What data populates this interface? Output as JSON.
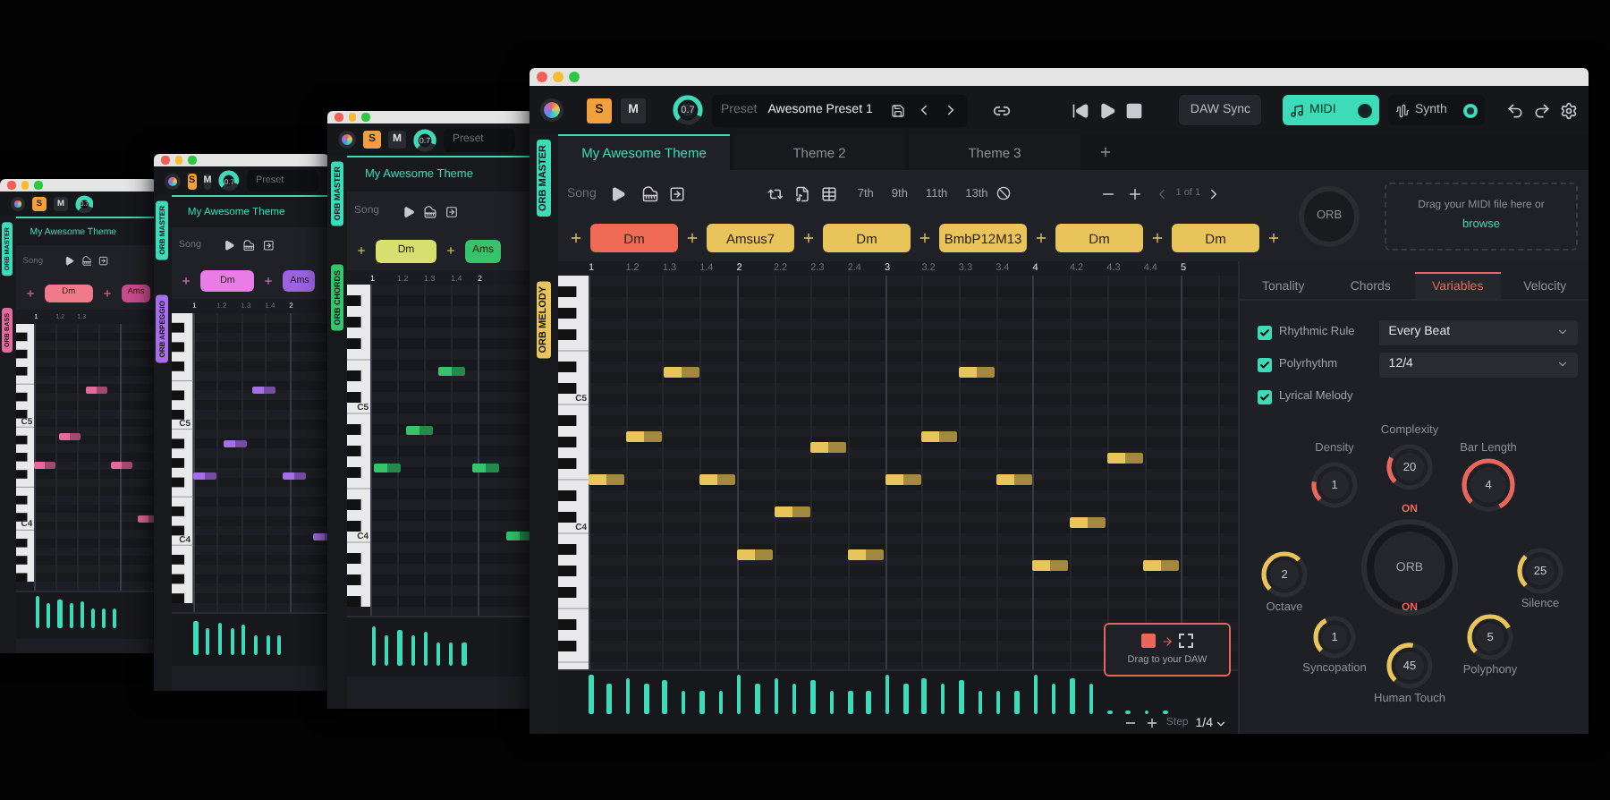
{
  "windows": [
    {
      "color": "#e56a9c",
      "toolbar": {
        "solo": {
          "label": "S",
          "on": true
        },
        "mute": {
          "label": "M",
          "on": false
        },
        "knob": {
          "value": "0.7",
          "level": 0.7
        }
      },
      "tags": [
        {
          "label": "ORB MASTER",
          "color": "#3ddbb8"
        },
        {
          "label": "ORB BASS",
          "color": "#e56a9c"
        }
      ],
      "theme": "My Awesome Theme",
      "song": "Song",
      "chords": [
        {
          "label": "Dm",
          "color": "#f07a8a"
        },
        {
          "label": "Ams",
          "color": "#c94d8e"
        }
      ],
      "ruler": [
        "1",
        "1.2",
        "1.3"
      ],
      "key_labels": [
        "C5",
        "C4"
      ]
    },
    {
      "color": "#a66ee8",
      "toolbar": {
        "solo": {
          "label": "S",
          "on": true
        },
        "mute": {
          "label": "M",
          "on": false
        },
        "knob": {
          "value": "0.7",
          "level": 0.7
        },
        "preset": "Preset"
      },
      "tags": [
        {
          "label": "ORB MASTER",
          "color": "#3ddbb8"
        },
        {
          "label": "ORB ARPEGGIO",
          "color": "#a66ee8"
        }
      ],
      "theme": "My Awesome Theme",
      "song": "Song",
      "chords": [
        {
          "label": "Dm",
          "color": "#ea7ce8"
        },
        {
          "label": "Ams",
          "color": "#9b63e0"
        }
      ],
      "ruler": [
        "1",
        "1.2",
        "1.3",
        "1.4",
        "2"
      ],
      "key_labels": [
        "C5",
        "C4"
      ]
    },
    {
      "color": "#35c46c",
      "toolbar": {
        "solo": {
          "label": "S",
          "on": true
        },
        "mute": {
          "label": "M",
          "on": false
        },
        "knob": {
          "value": "0.7",
          "level": 0.7
        },
        "preset": "Preset"
      },
      "tags": [
        {
          "label": "ORB MASTER",
          "color": "#3ddbb8"
        },
        {
          "label": "ORB CHORDS",
          "color": "#35c46c"
        }
      ],
      "theme": "My Awesome Theme",
      "song": "Song",
      "chords": [
        {
          "label": "Dm",
          "color": "#d7df6e"
        },
        {
          "label": "Ams",
          "color": "#35c46c"
        }
      ],
      "ruler": [
        "1",
        "1.2",
        "1.3",
        "1.4",
        "2"
      ],
      "key_labels": [
        "C5",
        "C4"
      ]
    }
  ],
  "main": {
    "toolbar": {
      "solo": {
        "label": "S",
        "on": true
      },
      "mute": {
        "label": "M",
        "on": false
      },
      "knob": {
        "value": "0.7",
        "level": 0.7
      },
      "preset": {
        "label": "Preset",
        "value": "Awesome Preset 1"
      },
      "daw_sync": "DAW Sync",
      "modes": [
        {
          "label": "MIDI",
          "selected": true
        },
        {
          "label": "Synth",
          "selected": false
        }
      ]
    },
    "tags": [
      {
        "label": "ORB MASTER",
        "color": "#3ddbb8"
      },
      {
        "label": "ORB MELODY",
        "color": "#e8c45a"
      }
    ],
    "tabs": [
      {
        "label": "My Awesome Theme",
        "selected": true
      },
      {
        "label": "Theme 2",
        "selected": false
      },
      {
        "label": "Theme 3",
        "selected": false
      }
    ],
    "controls": {
      "song": "Song",
      "extensions": [
        "7th",
        "9th",
        "11th",
        "13th"
      ],
      "page": "1 of 1"
    },
    "chords": [
      {
        "label": "Dm",
        "selected": true
      },
      {
        "label": "Amsus7",
        "selected": false
      },
      {
        "label": "Dm",
        "selected": false
      },
      {
        "label": "BmbP12M13",
        "selected": false
      },
      {
        "label": "Dm",
        "selected": false
      },
      {
        "label": "Dm",
        "selected": false
      }
    ],
    "orb": "ORB",
    "dropzone": {
      "text": "Drag your MIDI file here or",
      "link": "browse"
    },
    "ruler": [
      "1",
      "1.2",
      "1.3",
      "1.4",
      "2",
      "2.2",
      "2.3",
      "2.4",
      "3",
      "3.2",
      "3.3",
      "3.4",
      "4",
      "4.2",
      "4.3",
      "4.4",
      "5"
    ],
    "key_labels": [
      "C5",
      "C4"
    ],
    "drag_popup": "Drag to your DAW",
    "step": {
      "label": "Step",
      "value": "1/4"
    },
    "panel_tabs": [
      {
        "label": "Tonality",
        "selected": false
      },
      {
        "label": "Chords",
        "selected": false
      },
      {
        "label": "Variables",
        "selected": true
      },
      {
        "label": "Velocity",
        "selected": false
      }
    ],
    "options": [
      {
        "label": "Rhythmic Rule",
        "checked": true,
        "value": "Every Beat"
      },
      {
        "label": "Polyrhythm",
        "checked": true,
        "value": "12/4"
      },
      {
        "label": "Lyrical Melody",
        "checked": true
      }
    ],
    "knobs": [
      {
        "label": "Density",
        "value": "1",
        "level": 0.15,
        "color": "#e8675a"
      },
      {
        "label": "Complexity",
        "value": "20",
        "level": 0.2,
        "color": "#e8675a"
      },
      {
        "label": "Bar Length",
        "value": "4",
        "level": 0.8,
        "color": "#e8675a"
      },
      {
        "label": "Octave",
        "value": "2",
        "level": 0.5,
        "color": "#e8c45a"
      },
      {
        "label": "Silence",
        "value": "25",
        "level": 0.25,
        "color": "#e8c45a"
      },
      {
        "label": "Syncopation",
        "value": "1",
        "level": 0.3,
        "color": "#e8c45a"
      },
      {
        "label": "Polyphony",
        "value": "5",
        "level": 0.55,
        "color": "#e8c45a"
      },
      {
        "label": "Human Touch",
        "value": "45",
        "level": 0.4,
        "color": "#e8c45a"
      }
    ],
    "orb_center": {
      "label": "ORB",
      "top": "ON",
      "bottom": "ON"
    }
  }
}
